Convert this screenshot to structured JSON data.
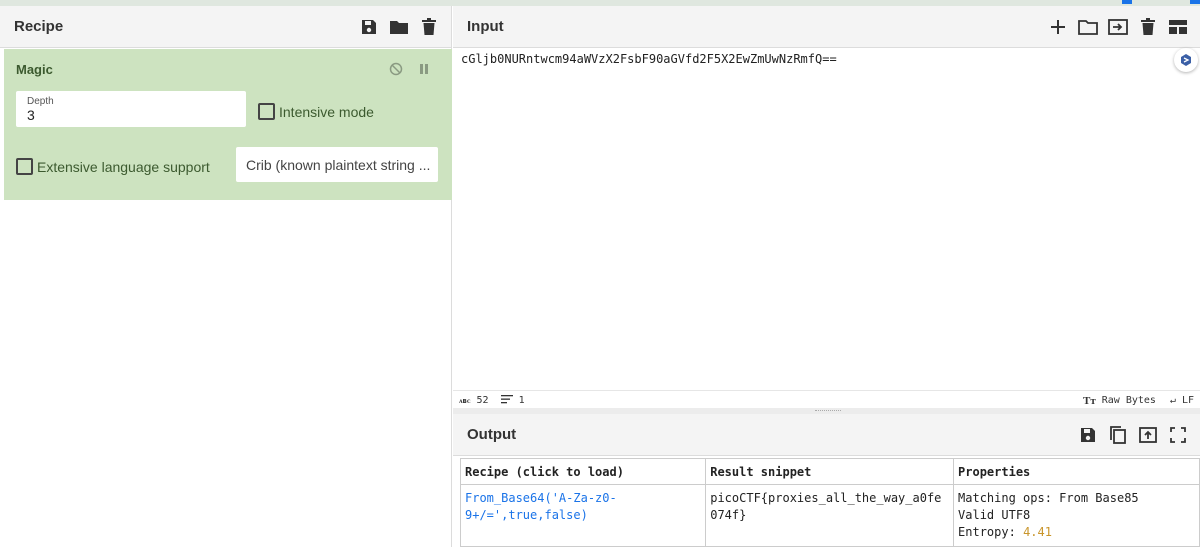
{
  "recipe": {
    "title": "Recipe",
    "icons": [
      "save-icon",
      "folder-icon",
      "trash-icon"
    ],
    "operation": {
      "name": "Magic",
      "depth_label": "Depth",
      "depth_value": "3",
      "intensive_label": "Intensive mode",
      "extensive_label": "Extensive language support",
      "crib_placeholder": "Crib (known plaintext string ..."
    }
  },
  "input": {
    "title": "Input",
    "text": "cGljb0NURntwcm94aWVzX2FsbF90aGVfd2F5X2EwZmUwNzRmfQ==",
    "status": {
      "length": "52",
      "lines": "1",
      "encoding": "Raw Bytes",
      "eol": "LF"
    }
  },
  "output": {
    "title": "Output",
    "table": {
      "headers": [
        "Recipe (click to load)",
        "Result snippet",
        "Properties"
      ],
      "row": {
        "recipe_line1": "From_Base64('A-Za-z0-",
        "recipe_line2": "9+/=',true,false)",
        "result_line1": "picoCTF{proxies_all_the_way_a0fe",
        "result_line2": "074f}",
        "prop1": "Matching ops: From Base85",
        "prop2": "Valid UTF8",
        "prop3_label": "Entropy: ",
        "prop3_value": "4.41"
      }
    }
  },
  "colors": {
    "op_bg": "#cde3c0",
    "link": "#1a73e8",
    "entropy": "#c9952b"
  }
}
